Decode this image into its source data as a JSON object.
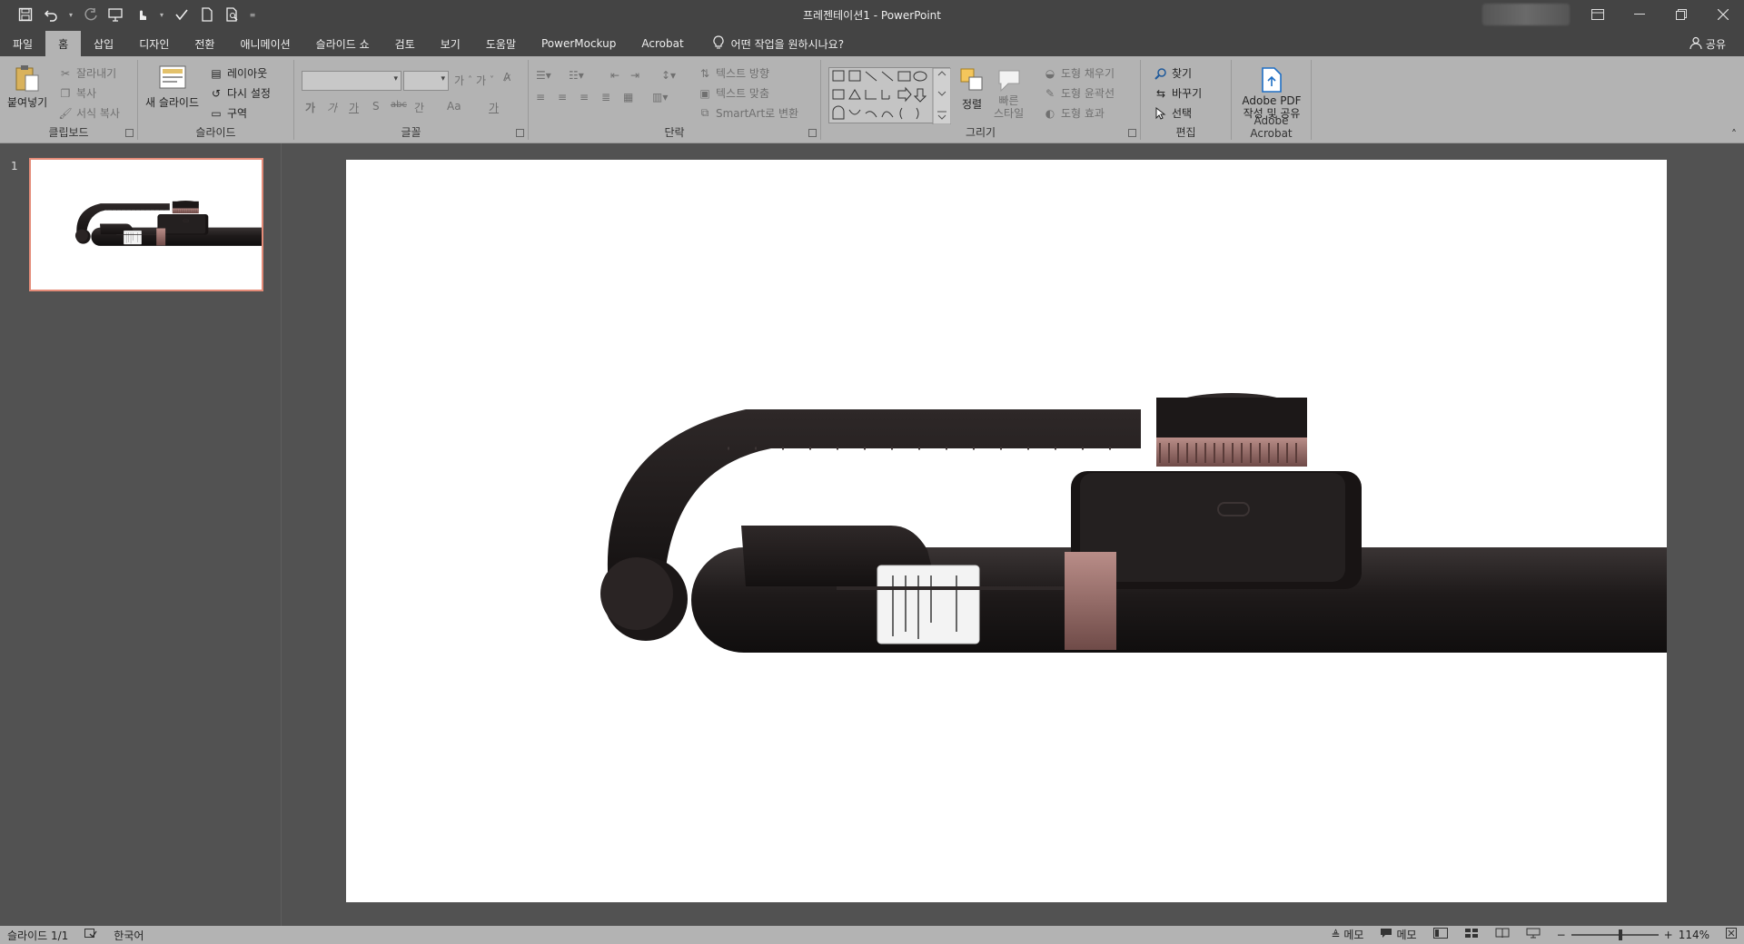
{
  "app": {
    "document_title": "프레젠테이션1",
    "separator": "-",
    "app_name": "PowerPoint"
  },
  "tabs": [
    {
      "label": "파일"
    },
    {
      "label": "홈"
    },
    {
      "label": "삽입"
    },
    {
      "label": "디자인"
    },
    {
      "label": "전환"
    },
    {
      "label": "애니메이션"
    },
    {
      "label": "슬라이드 쇼"
    },
    {
      "label": "검토"
    },
    {
      "label": "보기"
    },
    {
      "label": "도움말"
    },
    {
      "label": "PowerMockup"
    },
    {
      "label": "Acrobat"
    }
  ],
  "tell_me": "어떤 작업을 원하시나요?",
  "share_label": "공유",
  "ribbon": {
    "clipboard": {
      "group_label": "클립보드",
      "paste": "붙여넣기",
      "cut": "잘라내기",
      "copy": "복사",
      "format_painter": "서식 복사"
    },
    "slides": {
      "group_label": "슬라이드",
      "new_slide": "새 슬라이드",
      "layout": "레이아웃",
      "reset": "다시 설정",
      "section": "구역"
    },
    "font": {
      "group_label": "글꼴",
      "bold": "가",
      "italic": "가",
      "underline": "가",
      "shadow": "S",
      "strike": "abc",
      "spacing": "간",
      "case": "Aa",
      "color": "가"
    },
    "paragraph": {
      "group_label": "단락",
      "text_direction": "텍스트 방향",
      "align_text": "텍스트 맞춤",
      "smartart": "SmartArt로 변환"
    },
    "drawing": {
      "group_label": "그리기",
      "arrange": "정렬",
      "quick_styles": "빠른\n스타일",
      "shape_fill": "도형 채우기",
      "shape_outline": "도형 윤곽선",
      "shape_effects": "도형 효과"
    },
    "editing": {
      "group_label": "편집",
      "find": "찾기",
      "replace": "바꾸기",
      "select": "선택"
    },
    "acrobat": {
      "group_label": "Adobe Acrobat",
      "create_pdf_line1": "Adobe PDF",
      "create_pdf_line2": "작성 및 공유"
    }
  },
  "thumbnails": [
    {
      "number": "1"
    }
  ],
  "status": {
    "slide_counter": "슬라이드 1/1",
    "language": "한국어",
    "notes": "메모",
    "comments": "메모",
    "zoom": "114%",
    "zoom_minus": "−",
    "zoom_plus": "+"
  },
  "colors": {
    "title_bar": "#444444",
    "ribbon": "#b3b3b3",
    "workspace": "#525252",
    "thumb_selected": "#e48b78"
  }
}
